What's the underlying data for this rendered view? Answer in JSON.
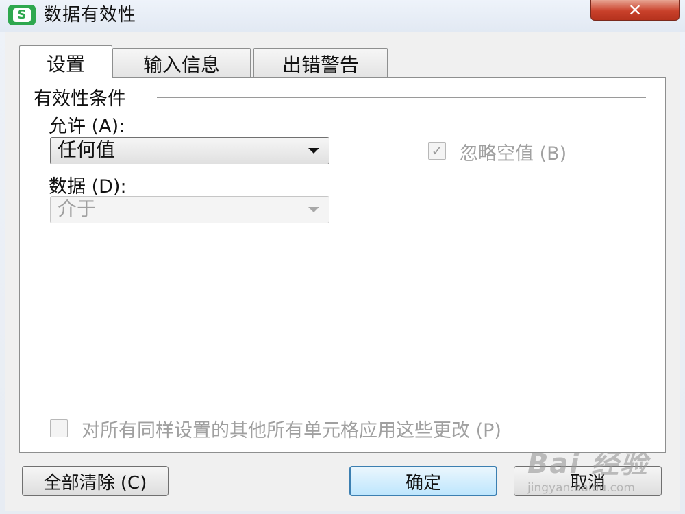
{
  "window": {
    "title": "数据有效性",
    "app_icon_letter": "S",
    "close_symbol": "✕"
  },
  "tabs": [
    {
      "label": "设置",
      "active": true
    },
    {
      "label": "输入信息",
      "active": false
    },
    {
      "label": "出错警告",
      "active": false
    }
  ],
  "settings": {
    "group_title": "有效性条件",
    "allow_label": "允许 (A):",
    "allow_value": "任何值",
    "data_label": "数据 (D):",
    "data_value": "介于",
    "ignore_blank_label": "忽略空值 (B)",
    "ignore_blank_checked": true,
    "apply_all_label": "对所有同样设置的其他所有单元格应用这些更改 (P)",
    "apply_all_checked": false
  },
  "buttons": {
    "clear_all": "全部清除 (C)",
    "ok": "确定",
    "cancel": "取消"
  },
  "watermark": {
    "logo": "Bai 经验",
    "url": "jingyan.baidu.com"
  },
  "colors": {
    "app_icon": "#2fa84f",
    "close_button": "#c9412b",
    "default_button_border": "#3c7fb1"
  }
}
